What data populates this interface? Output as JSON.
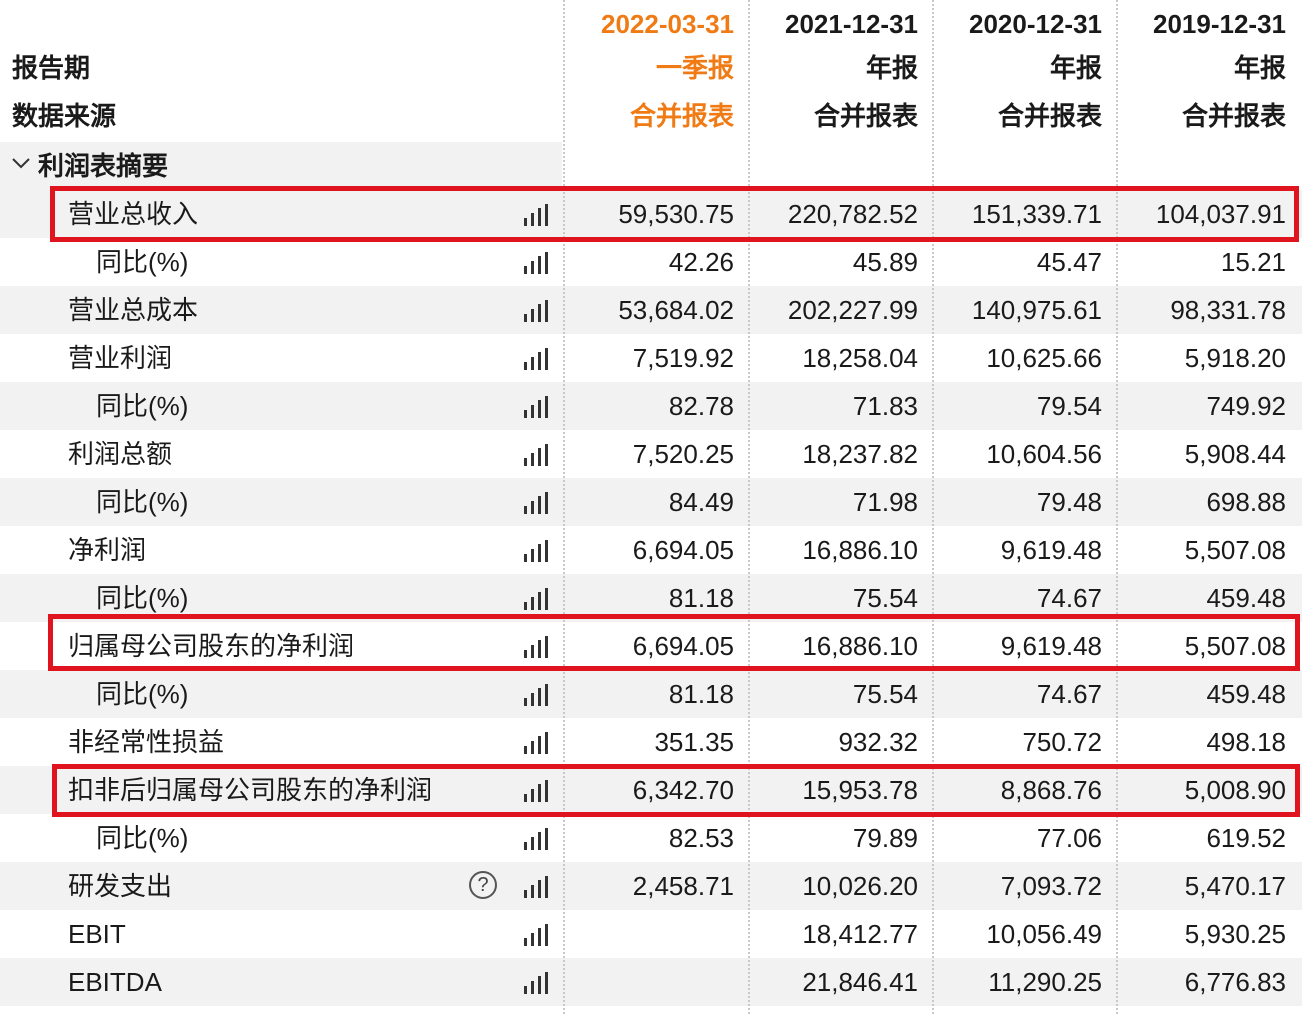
{
  "header": {
    "periods": [
      "2022-03-31",
      "2021-12-31",
      "2020-12-31",
      "2019-12-31"
    ],
    "report_period_label": "报告期",
    "report_types": [
      "一季报",
      "年报",
      "年报",
      "年报"
    ],
    "data_source_label": "数据来源",
    "data_sources": [
      "合并报表",
      "合并报表",
      "合并报表",
      "合并报表"
    ]
  },
  "section": {
    "title": "利润表摘要",
    "toggle_icon": "chevron-down-icon"
  },
  "colors": {
    "accent_orange": "#f07a14",
    "highlight_red": "#e0141e",
    "row_shade": "#f2f2f2"
  },
  "rows": [
    {
      "label": "营业总收入",
      "values": [
        "59,530.75",
        "220,782.52",
        "151,339.71",
        "104,037.91"
      ]
    },
    {
      "label": "同比(%)",
      "values": [
        "42.26",
        "45.89",
        "45.47",
        "15.21"
      ]
    },
    {
      "label": "营业总成本",
      "values": [
        "53,684.02",
        "202,227.99",
        "140,975.61",
        "98,331.78"
      ]
    },
    {
      "label": "营业利润",
      "values": [
        "7,519.92",
        "18,258.04",
        "10,625.66",
        "5,918.20"
      ]
    },
    {
      "label": "同比(%)",
      "values": [
        "82.78",
        "71.83",
        "79.54",
        "749.92"
      ]
    },
    {
      "label": "利润总额",
      "values": [
        "7,520.25",
        "18,237.82",
        "10,604.56",
        "5,908.44"
      ]
    },
    {
      "label": "同比(%)",
      "values": [
        "84.49",
        "71.98",
        "79.48",
        "698.88"
      ]
    },
    {
      "label": "净利润",
      "values": [
        "6,694.05",
        "16,886.10",
        "9,619.48",
        "5,507.08"
      ]
    },
    {
      "label": "同比(%)",
      "values": [
        "81.18",
        "75.54",
        "74.67",
        "459.48"
      ]
    },
    {
      "label": "归属母公司股东的净利润",
      "values": [
        "6,694.05",
        "16,886.10",
        "9,619.48",
        "5,507.08"
      ]
    },
    {
      "label": "同比(%)",
      "values": [
        "81.18",
        "75.54",
        "74.67",
        "459.48"
      ]
    },
    {
      "label": "非经常性损益",
      "values": [
        "351.35",
        "932.32",
        "750.72",
        "498.18"
      ]
    },
    {
      "label": "扣非后归属母公司股东的净利润",
      "values": [
        "6,342.70",
        "15,953.78",
        "8,868.76",
        "5,008.90"
      ]
    },
    {
      "label": "同比(%)",
      "values": [
        "82.53",
        "79.89",
        "77.06",
        "619.52"
      ]
    },
    {
      "label": "研发支出",
      "values": [
        "2,458.71",
        "10,026.20",
        "7,093.72",
        "5,470.17"
      ]
    },
    {
      "label": "EBIT",
      "values": [
        "",
        "18,412.77",
        "10,056.49",
        "5,930.25"
      ]
    },
    {
      "label": "EBITDA",
      "values": [
        "",
        "21,846.41",
        "11,290.25",
        "6,776.83"
      ]
    }
  ]
}
